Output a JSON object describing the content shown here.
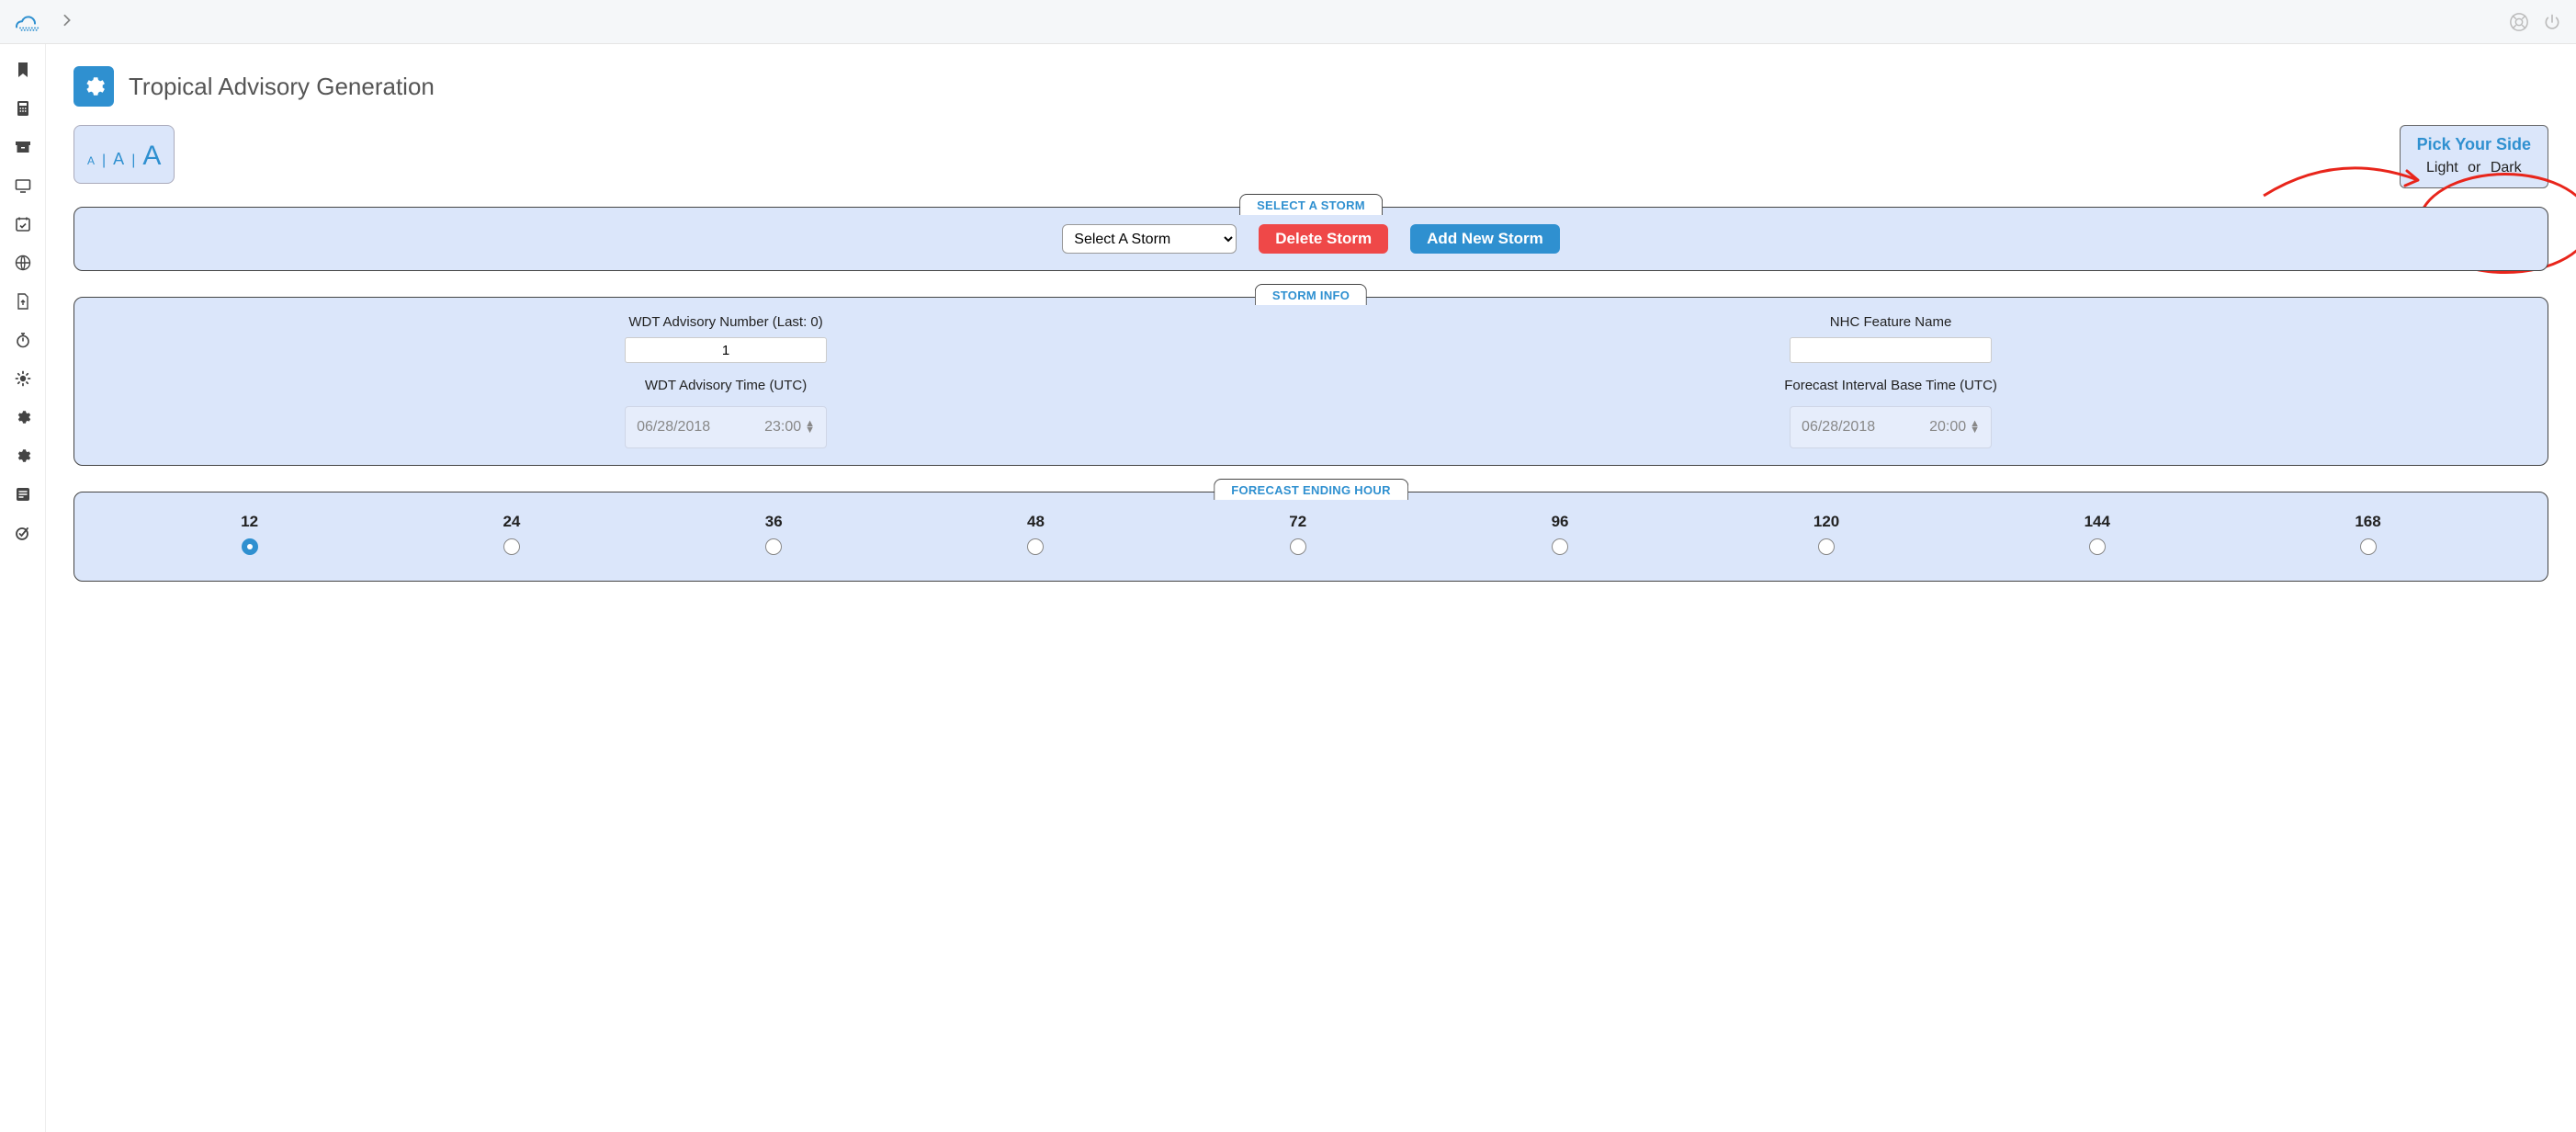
{
  "header": {
    "title": "Tropical Advisory Generation"
  },
  "theme": {
    "title": "Pick Your Side",
    "light": "Light",
    "or": "or",
    "dark": "Dark"
  },
  "fontsize": {
    "small": "A",
    "medium": "A",
    "large": "A"
  },
  "panels": {
    "select_storm": {
      "tab": "SELECT A STORM",
      "placeholder": "Select A Storm",
      "delete_btn": "Delete Storm",
      "add_btn": "Add New Storm"
    },
    "storm_info": {
      "tab": "STORM INFO",
      "wdt_num_label": "WDT Advisory Number (Last: 0)",
      "wdt_num_value": "1",
      "wdt_time_label": "WDT Advisory Time (UTC)",
      "wdt_date": "06/28/2018",
      "wdt_time": "23:00",
      "nhc_name_label": "NHC Feature Name",
      "nhc_name_value": "",
      "interval_label": "Forecast Interval Base Time (UTC)",
      "interval_date": "06/28/2018",
      "interval_time": "20:00"
    },
    "forecast": {
      "tab": "FORECAST ENDING HOUR",
      "hours": [
        "12",
        "24",
        "36",
        "48",
        "72",
        "96",
        "120",
        "144",
        "168"
      ],
      "selected_index": 0
    }
  }
}
